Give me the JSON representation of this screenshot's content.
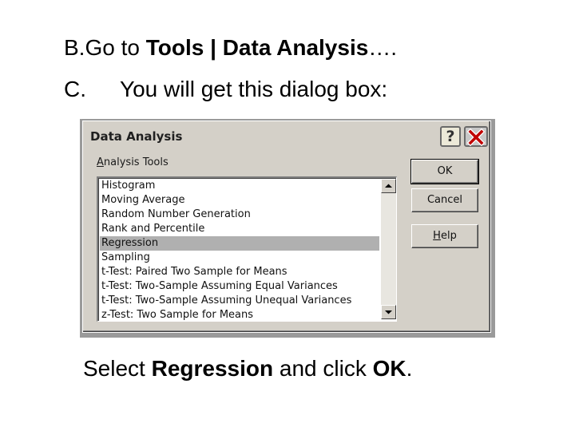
{
  "slide": {
    "line_b": {
      "prefix": "B.Go to ",
      "bold": "Tools | Data Analysis",
      "suffix": "…."
    },
    "line_c": {
      "num": "C.",
      "text": "You will get this dialog box:"
    },
    "line_select": {
      "p1": "Select ",
      "b1": "Regression",
      "p2": " and click ",
      "b2": "OK",
      "p3": "."
    }
  },
  "dialog": {
    "title": "Data Analysis",
    "help_glyph": "?",
    "group_label": "Analysis Tools",
    "group_label_underline": "A",
    "group_label_rest": "nalysis Tools",
    "list_items": [
      "Histogram",
      "Moving Average",
      "Random Number Generation",
      "Rank and Percentile",
      "Regression",
      "Sampling",
      "t-Test: Paired Two Sample for Means",
      "t-Test: Two-Sample Assuming Equal Variances",
      "t-Test: Two-Sample Assuming Unequal Variances",
      "z-Test: Two Sample for Means"
    ],
    "selected_item": "Regression",
    "buttons": {
      "ok": "OK",
      "cancel": "Cancel",
      "help_underline": "H",
      "help_rest": "elp"
    }
  },
  "colors": {
    "dialog_face": "#d4d0c8",
    "selection": "#b0b0b0",
    "close_x": "#c00000"
  },
  "icons": {
    "help": "question-mark-icon",
    "close": "close-x-icon",
    "scroll_up": "arrow-up-icon",
    "scroll_down": "arrow-down-icon"
  }
}
